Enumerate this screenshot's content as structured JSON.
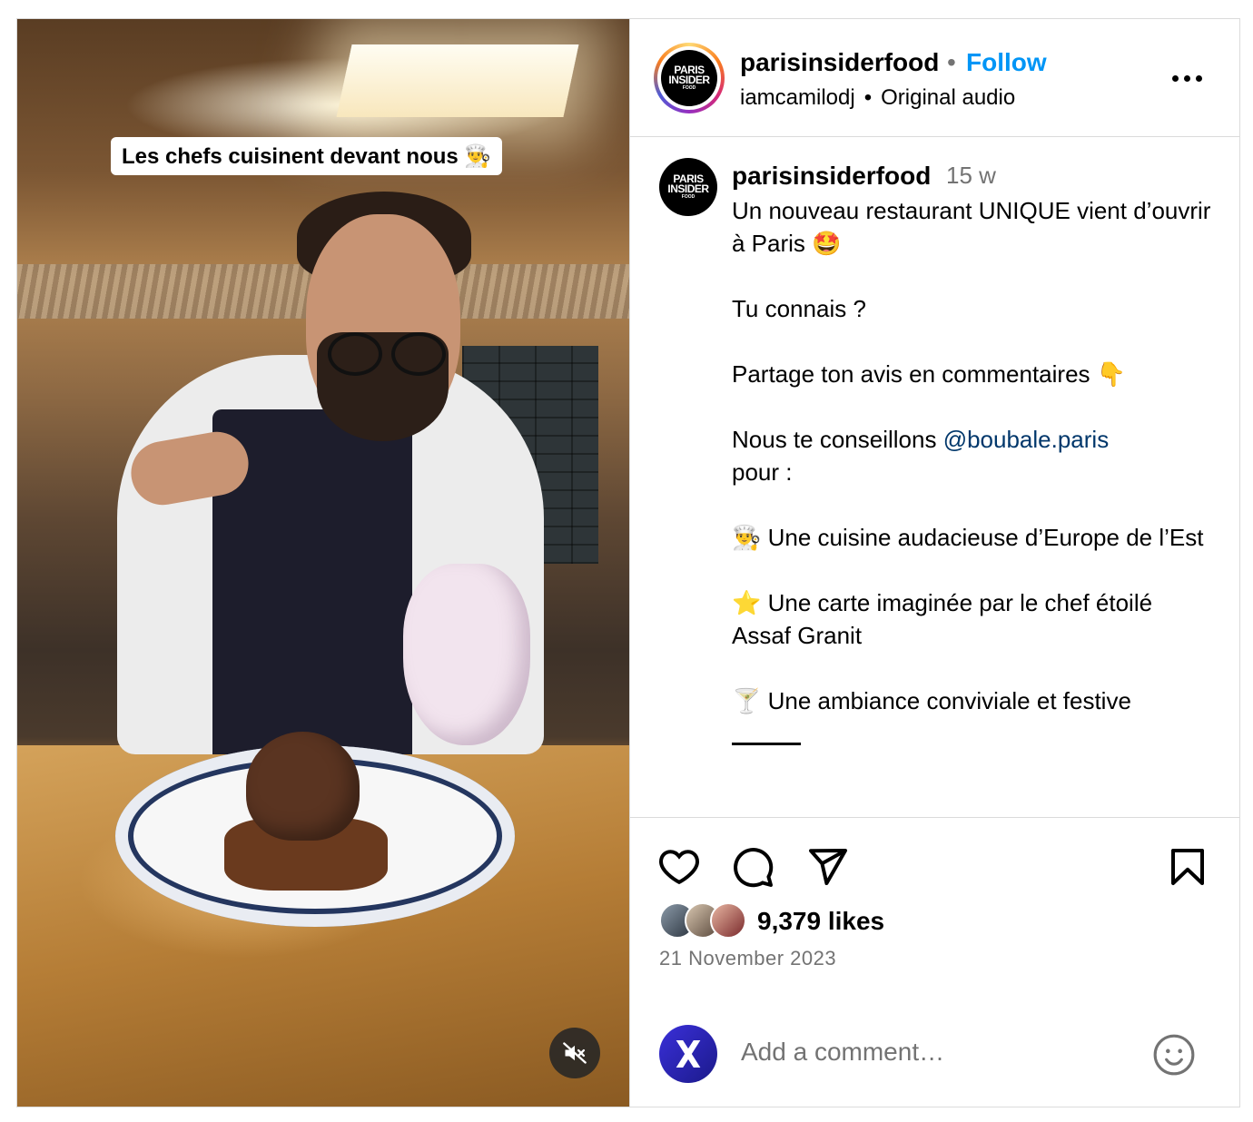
{
  "video": {
    "overlay_caption": "Les chefs cuisinent devant nous 👨‍🍳",
    "mute_icon": "muted-speaker-icon"
  },
  "header": {
    "avatar_logo": [
      "PARIS",
      "INSIDER",
      "FOOD"
    ],
    "username": "parisinsiderfood",
    "separator": "•",
    "follow_label": "Follow",
    "audio_author": "iamcamilodj",
    "audio_separator": "•",
    "audio_label": "Original audio",
    "more_icon": "more-options-icon"
  },
  "caption": {
    "username": "parisinsiderfood",
    "time": "15 w",
    "line1": "Un nouveau restaurant UNIQUE vient d’ouvrir à Paris 🤩",
    "line2": "Tu connais ?",
    "line3": "Partage ton avis en commentaires 👇",
    "line4_prefix": "Nous te conseillons ",
    "mention": "@boubale.paris",
    "line4_suffix": "pour :",
    "bullet1": "👨‍🍳 Une cuisine audacieuse d’Europe de l’Est",
    "bullet2": "⭐️ Une carte imaginée par le chef étoilé Assaf Granit",
    "bullet3": "🍸 Une ambiance conviviale et festive"
  },
  "actions": {
    "like_icon": "heart-icon",
    "comment_icon": "comment-icon",
    "share_icon": "share-icon",
    "save_icon": "bookmark-icon"
  },
  "likes": {
    "count_label": "9,379 likes"
  },
  "date": "21 November 2023",
  "comment_box": {
    "placeholder": "Add a comment…",
    "emoji_icon": "emoji-icon"
  },
  "colors": {
    "follow": "#0095f6",
    "mention": "#00376b",
    "muted_text": "#737373",
    "border": "#dbdbdb"
  }
}
